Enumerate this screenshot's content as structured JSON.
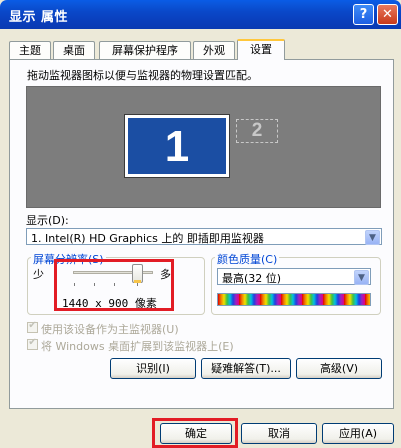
{
  "window": {
    "title": "显示 属性",
    "help_glyph": "?",
    "close_glyph": "✕"
  },
  "tabs": [
    {
      "label": "主题"
    },
    {
      "label": "桌面"
    },
    {
      "label": "屏幕保护程序"
    },
    {
      "label": "外观"
    },
    {
      "label": "设置",
      "active": true
    }
  ],
  "settings": {
    "instruction": "拖动监视器图标以便与监视器的物理设置匹配。",
    "monitor_1": "1",
    "monitor_2": "2",
    "display_label": "显示(D):",
    "display_value": "1. Intel(R) HD Graphics 上的 即插即用监视器",
    "resolution": {
      "title": "屏幕分辨率(S)",
      "less": "少",
      "more": "多",
      "value_text": "1440 x 900 像素",
      "slider_level_percent": 100
    },
    "color_quality": {
      "title": "颜色质量(C)",
      "value": "最高(32 位)"
    },
    "primary_checkbox": "使用该设备作为主监视器(U)",
    "extend_checkbox": "将 Windows 桌面扩展到该监视器上(E)",
    "identify_button": "识别(I)",
    "troubleshoot_button": "疑难解答(T)...",
    "advanced_button": "高级(V)"
  },
  "footer": {
    "ok": "确定",
    "cancel": "取消",
    "apply": "应用(A)"
  },
  "colors": {
    "titlebar": "#0A48C9",
    "highlight_box": "#E21C25",
    "monitor_active": "#1B4EA3"
  }
}
